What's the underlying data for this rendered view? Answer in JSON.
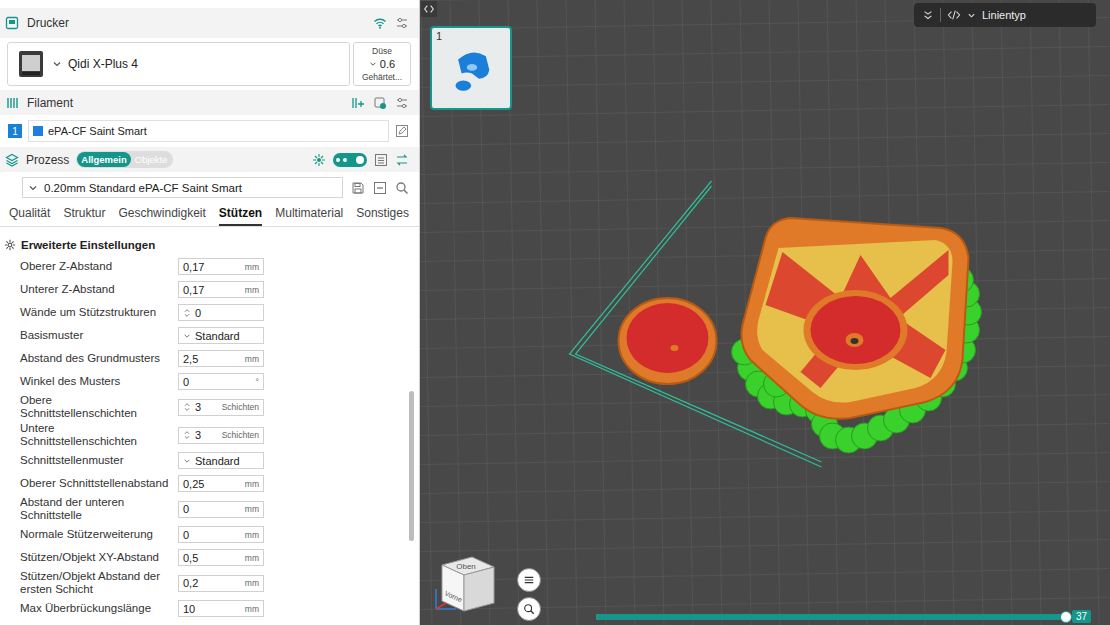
{
  "printer_section": {
    "title": "Drucker"
  },
  "printer": {
    "name": "Qidi X-Plus 4",
    "nozzle_label": "Düse",
    "nozzle_size": "0.6",
    "nozzle_type": "Gehärtet..."
  },
  "filament_section": {
    "title": "Filament"
  },
  "filaments": [
    {
      "index": "1",
      "name": "ePA-CF Saint Smart",
      "color": "#1e7fe0"
    }
  ],
  "process_section": {
    "title": "Prozess",
    "modes": [
      {
        "label": "Allgemein",
        "selected": true
      },
      {
        "label": "Objekte",
        "selected": false
      }
    ],
    "advanced_on": true
  },
  "preset": {
    "name": "0.20mm Standard ePA-CF Saint Smart"
  },
  "tabs": [
    {
      "label": "Qualität",
      "selected": false
    },
    {
      "label": "Struktur",
      "selected": false
    },
    {
      "label": "Geschwindigkeit",
      "selected": false
    },
    {
      "label": "Stützen",
      "selected": true
    },
    {
      "label": "Multimaterial",
      "selected": false
    },
    {
      "label": "Sonstiges",
      "selected": false
    }
  ],
  "settings_group": {
    "title": "Erweiterte Einstellungen",
    "scroll_level": 0.66
  },
  "settings": [
    {
      "label": "Oberer Z-Abstand",
      "kind": "number",
      "value": "0,17",
      "unit": "mm"
    },
    {
      "label": "Unterer Z-Abstand",
      "kind": "number",
      "value": "0,17",
      "unit": "mm"
    },
    {
      "label": "Wände um Stützstrukturen",
      "kind": "spin",
      "value": "0",
      "unit": ""
    },
    {
      "label": "Basismuster",
      "kind": "select",
      "value": "Standard",
      "unit": ""
    },
    {
      "label": "Abstand des Grundmusters",
      "kind": "number",
      "value": "2,5",
      "unit": "mm"
    },
    {
      "label": "Winkel des Musters",
      "kind": "number",
      "value": "0",
      "unit": "°"
    },
    {
      "label": "Obere Schnittstellenschichten",
      "kind": "spin",
      "value": "3",
      "unit": "Schichten"
    },
    {
      "label": "Untere Schnittstellenschichten",
      "kind": "spin",
      "value": "3",
      "unit": "Schichten"
    },
    {
      "label": "Schnittstellenmuster",
      "kind": "select",
      "value": "Standard",
      "unit": ""
    },
    {
      "label": "Oberer Schnittstellenabstand",
      "kind": "number",
      "value": "0,25",
      "unit": "mm"
    },
    {
      "label": "Abstand der unteren Schnittstelle",
      "kind": "number",
      "value": "0",
      "unit": "mm"
    },
    {
      "label": "Normale Stützerweiterung",
      "kind": "number",
      "value": "0",
      "unit": "mm"
    },
    {
      "label": "Stützen/Objekt XY-Abstand",
      "kind": "number",
      "value": "0,5",
      "unit": "mm"
    },
    {
      "label": "Stützen/Objekt Abstand der ersten Schicht",
      "kind": "number",
      "value": "0,2",
      "unit": "mm"
    },
    {
      "label": "Max Überbrückungslänge",
      "kind": "number",
      "value": "10",
      "unit": "mm"
    }
  ],
  "viewport": {
    "plate": {
      "number": "1",
      "selected": true
    },
    "view_mode": "Linientyp",
    "view_cube": {
      "top": "Oben",
      "front": "Vorne"
    },
    "layer_slider": {
      "level": 1,
      "reading": "37"
    }
  }
}
